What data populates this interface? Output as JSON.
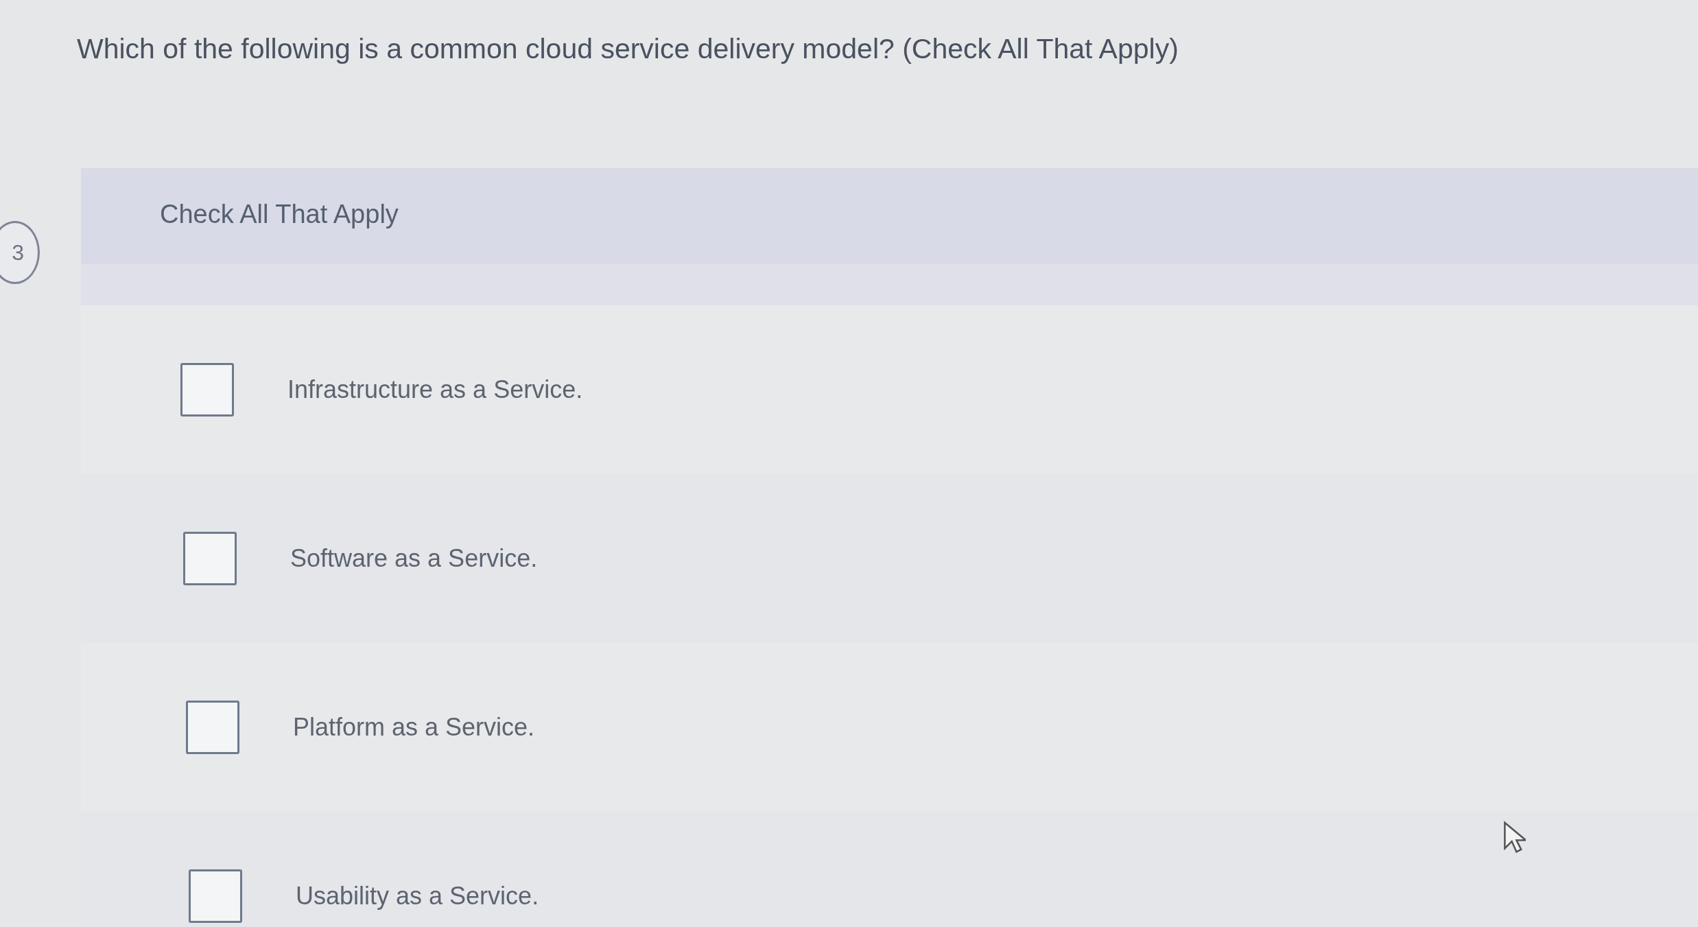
{
  "question": {
    "number": "3",
    "text": "Which of the following is a common cloud service delivery model? (Check All That Apply)"
  },
  "instructions": "Check All That Apply",
  "options": [
    {
      "label": "Infrastructure as a Service.",
      "checked": false
    },
    {
      "label": "Software as a Service.",
      "checked": false
    },
    {
      "label": "Platform as a Service.",
      "checked": false
    },
    {
      "label": "Usability as a Service.",
      "checked": false
    }
  ]
}
